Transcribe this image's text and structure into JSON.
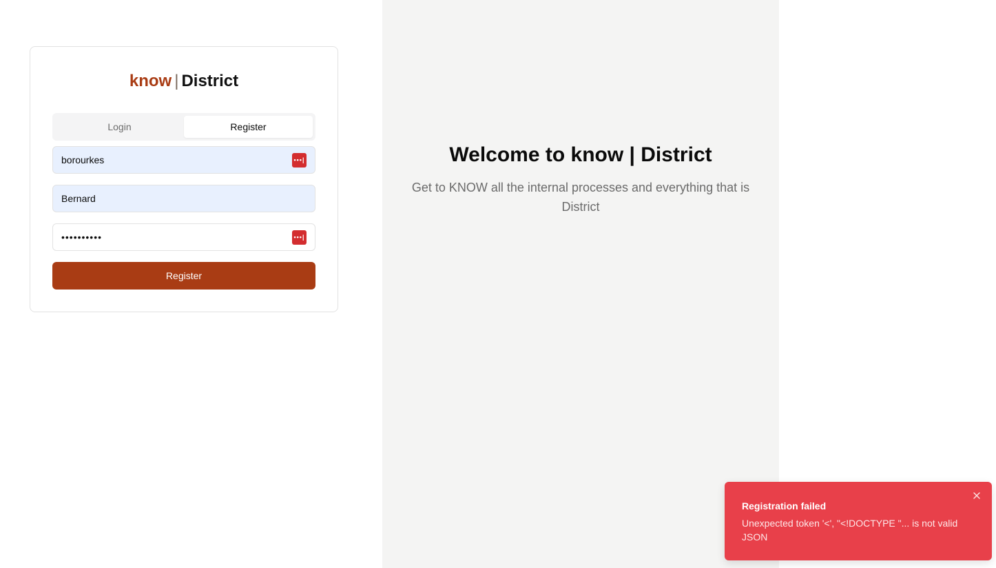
{
  "brand": {
    "part1": "know",
    "separator": "|",
    "part2": "District"
  },
  "tabs": [
    {
      "label": "Login",
      "active": false
    },
    {
      "label": "Register",
      "active": true
    }
  ],
  "form": {
    "username_value": "borourkes",
    "first_name_value": "Bernard",
    "password_masked": "••••••••••",
    "submit_label": "Register"
  },
  "panel": {
    "title": "Welcome to know | District",
    "subtitle": "Get to KNOW all the internal processes and everything that is District"
  },
  "toast": {
    "title": "Registration failed",
    "message": "Unexpected token '<', \"<!DOCTYPE \"... is not valid JSON",
    "close_icon": "close-icon"
  },
  "colors": {
    "accent": "#a93c14",
    "toast_bg": "#e8404a",
    "panel_bg": "#f4f4f3",
    "autofill_bg": "#e8f0fe",
    "password_manager_icon": "#d32d2f"
  }
}
